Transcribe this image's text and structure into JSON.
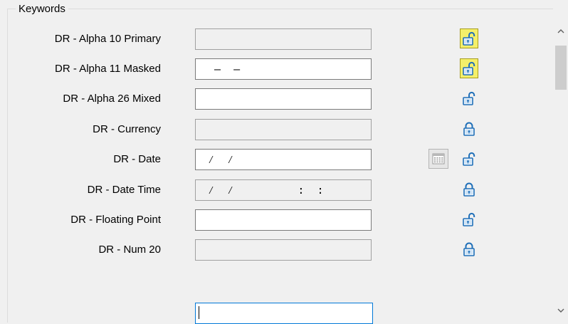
{
  "group": {
    "title": "Keywords"
  },
  "rows": [
    {
      "label": "DR - Alpha 10 Primary",
      "value": "",
      "editable": false,
      "lock": "active"
    },
    {
      "label": "DR - Alpha 11 Masked",
      "value": "  –  –",
      "editable": true,
      "lock": "active"
    },
    {
      "label": "DR - Alpha 26 Mixed",
      "value": "",
      "editable": true,
      "lock": "unlocked"
    },
    {
      "label": "DR - Currency",
      "value": "",
      "editable": false,
      "lock": "locked"
    },
    {
      "label": "DR - Date",
      "value": " ⁄  ⁄",
      "editable": true,
      "lock": "unlocked",
      "calendar": true
    },
    {
      "label": "DR - Date Time",
      "value": " ⁄  ⁄          :  :",
      "editable": false,
      "lock": "locked"
    },
    {
      "label": "DR - Floating Point",
      "value": "",
      "editable": true,
      "lock": "unlocked"
    },
    {
      "label": "DR - Num 20",
      "value": "",
      "editable": false,
      "lock": "locked"
    }
  ],
  "icons": {
    "lock_closed": "lock-icon",
    "lock_open": "unlock-icon",
    "calendar": "calendar-icon",
    "scroll_up": "chevron-up-icon",
    "scroll_down": "chevron-down-icon"
  },
  "colors": {
    "lock_active_bg": "#f4ef6a",
    "lock_blue": "#1f6fb8",
    "focus_border": "#0078d7"
  }
}
